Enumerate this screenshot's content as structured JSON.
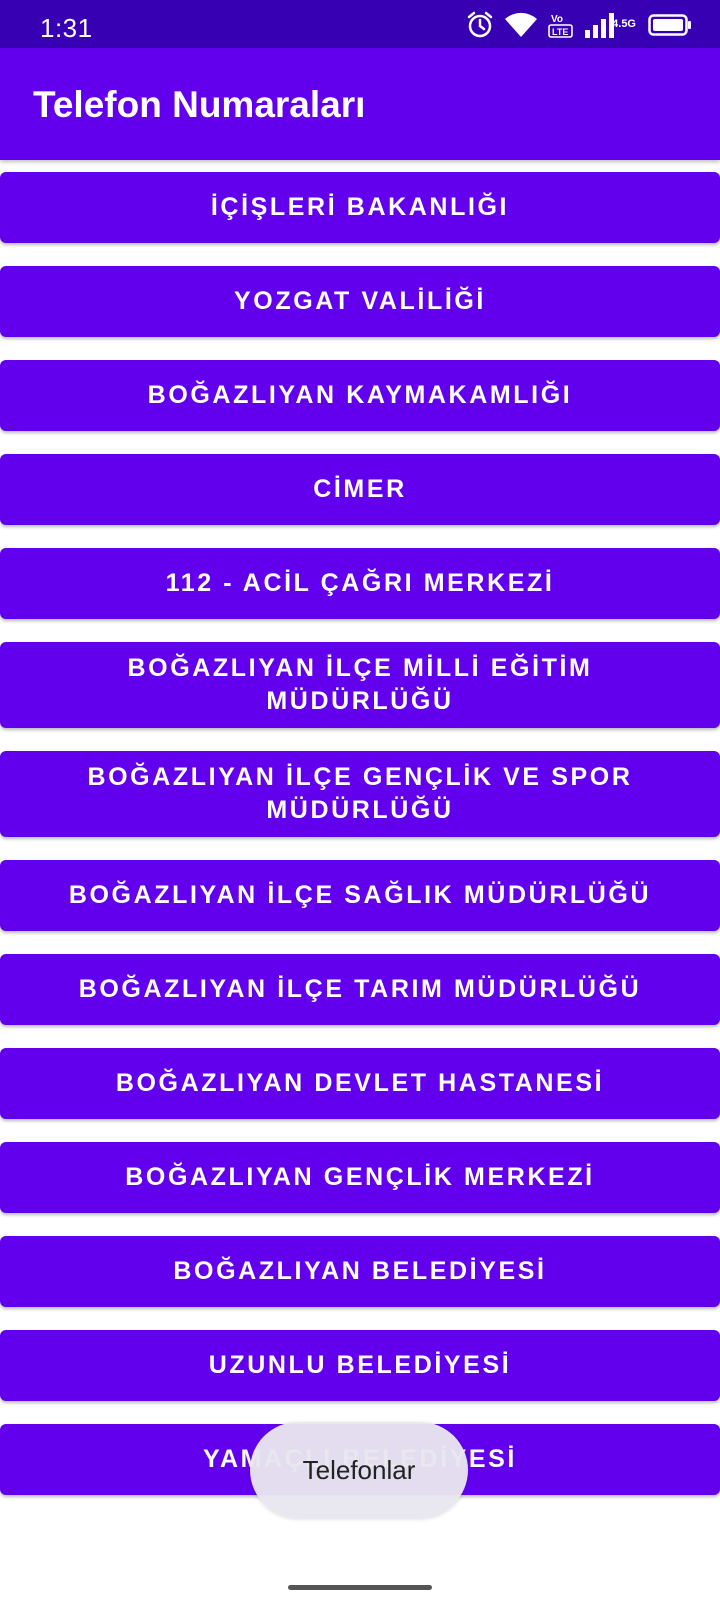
{
  "status_bar": {
    "time": "1:31",
    "network_label": "4.5G",
    "icons": [
      "alarm-icon",
      "wifi-icon",
      "volte-icon",
      "signal-icon",
      "battery-icon"
    ]
  },
  "app_bar": {
    "title": "Telefon Numaraları"
  },
  "buttons": [
    "İÇİŞLERİ BAKANLIĞI",
    "YOZGAT VALİLİĞİ",
    "BOĞAZLIYAN KAYMAKAMLIĞI",
    "CİMER",
    "112 - ACİL ÇAĞRI MERKEZİ",
    "BOĞAZLIYAN İLÇE MİLLİ EĞİTİM MÜDÜRLÜĞÜ",
    "BOĞAZLIYAN İLÇE GENÇLİK VE SPOR MÜDÜRLÜĞÜ",
    "BOĞAZLIYAN İLÇE SAĞLIK MÜDÜRLÜĞÜ",
    "BOĞAZLIYAN İLÇE TARIM MÜDÜRLÜĞÜ",
    "BOĞAZLIYAN DEVLET HASTANESİ",
    "BOĞAZLIYAN GENÇLİK MERKEZİ",
    "BOĞAZLIYAN BELEDİYESİ",
    "UZUNLU BELEDİYESİ",
    "YAMAÇLI BELEDİYESİ"
  ],
  "toast": {
    "text": "Telefonlar"
  },
  "colors": {
    "status_bar": "#3700b3",
    "primary": "#6200ee",
    "on_primary": "#ffffff",
    "toast_bg": "#e8e6ee"
  }
}
